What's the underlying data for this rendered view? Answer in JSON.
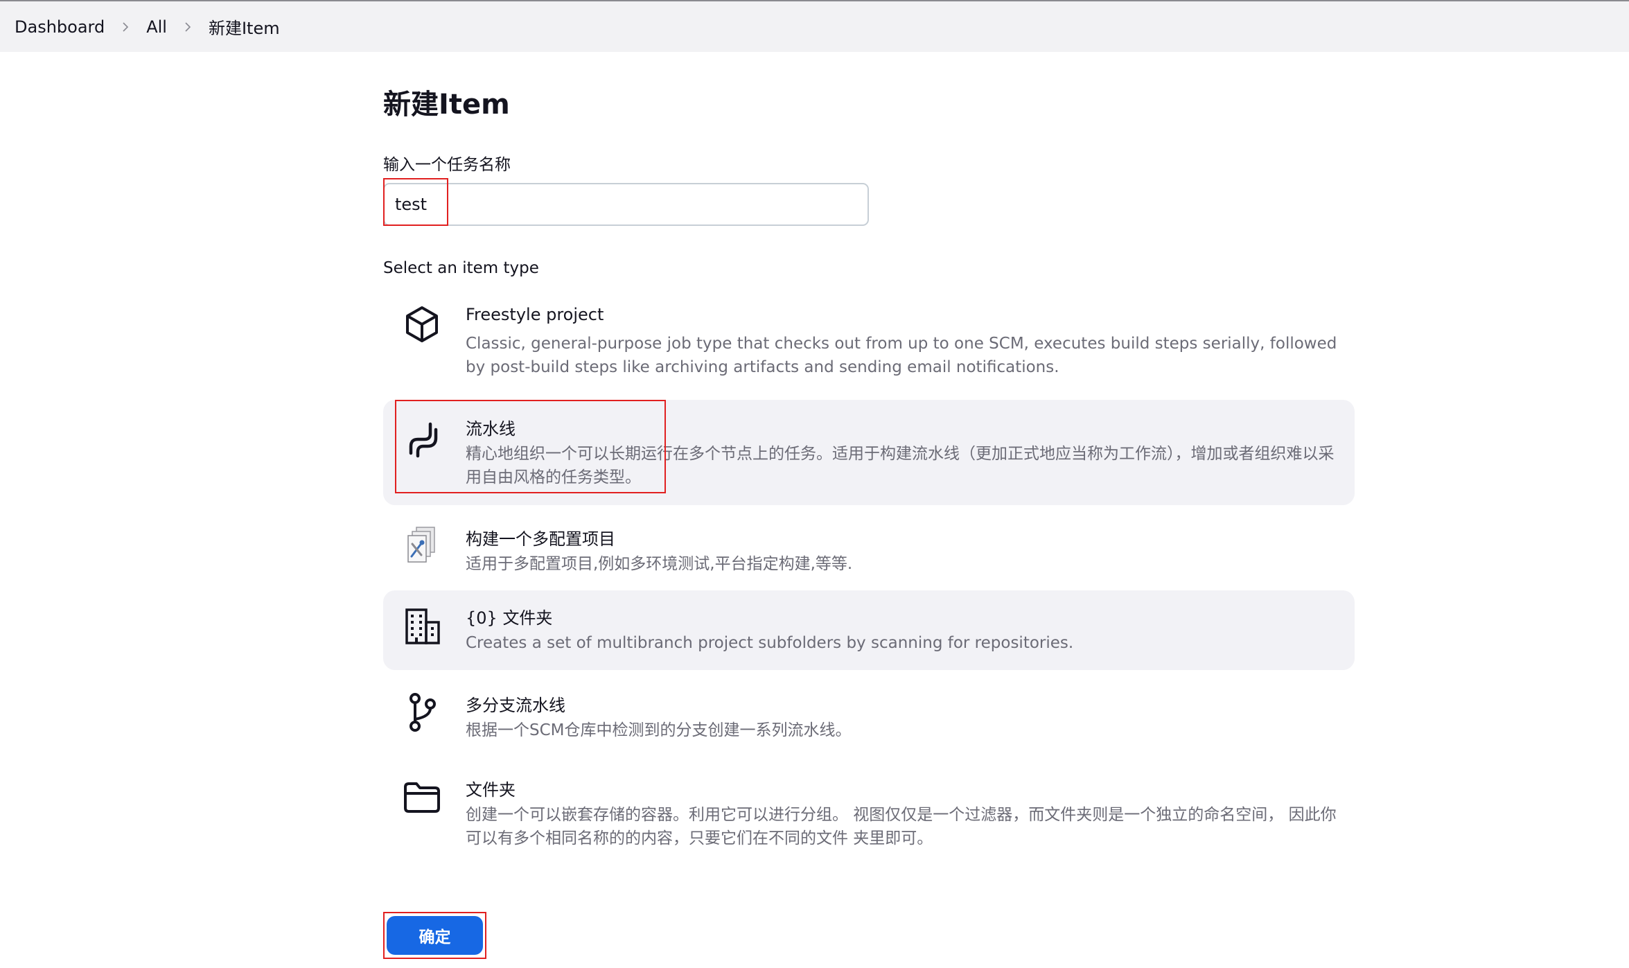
{
  "breadcrumb": {
    "items": [
      "Dashboard",
      "All",
      "新建Item"
    ]
  },
  "page": {
    "title": "新建Item",
    "name_label": "输入一个任务名称",
    "name_value": "test",
    "type_label": "Select an item type",
    "ok_label": "确定"
  },
  "item_types": [
    {
      "name": "Freestyle project",
      "icon": "cube-icon",
      "description": "Classic, general-purpose job type that checks out from up to one SCM, executes build steps serially, followed by post-build steps like archiving artifacts and sending email notifications."
    },
    {
      "name": "流水线",
      "icon": "pipeline-icon",
      "description": "精心地组织一个可以长期运行在多个节点上的任务。适用于构建流水线（更加正式地应当称为工作流），增加或者组织难以采用自由风格的任务类型。"
    },
    {
      "name": "构建一个多配置项目",
      "icon": "multi-config-icon",
      "description": "适用于多配置项目,例如多环境测试,平台指定构建,等等."
    },
    {
      "name": "{0} 文件夹",
      "icon": "building-icon",
      "description": "Creates a set of multibranch project subfolders by scanning for repositories."
    },
    {
      "name": "多分支流水线",
      "icon": "branch-icon",
      "description": "根据一个SCM仓库中检测到的分支创建一系列流水线。"
    },
    {
      "name": "文件夹",
      "icon": "folder-icon",
      "description": "创建一个可以嵌套存储的容器。利用它可以进行分组。 视图仅仅是一个过滤器，而文件夹则是一个独立的命名空间， 因此你可以有多个相同名称的的内容，只要它们在不同的文件 夹里即可。"
    }
  ],
  "colors": {
    "accent": "#1768e4",
    "highlight": "#e12020",
    "shaded_row": "#f2f2f6"
  }
}
